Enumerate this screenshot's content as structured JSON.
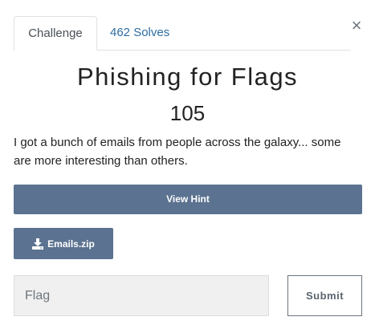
{
  "dialog": {
    "close_glyph": "×",
    "tabs": [
      {
        "label": "Challenge",
        "active": true
      },
      {
        "label": "462 Solves",
        "active": false
      }
    ],
    "title": "Phishing for Flags",
    "points": "105",
    "description": "I got a bunch of emails from people across the galaxy... some are more interesting than others.",
    "hint_button_label": "View Hint",
    "file": {
      "label": "Emails.zip",
      "icon": "download-icon"
    },
    "flag_input": {
      "placeholder": "Flag",
      "value": ""
    },
    "submit_label": "Submit"
  },
  "colors": {
    "button_bg": "#5b7290",
    "tab_link": "#2d6ea3",
    "input_bg": "#f0f0f0"
  }
}
